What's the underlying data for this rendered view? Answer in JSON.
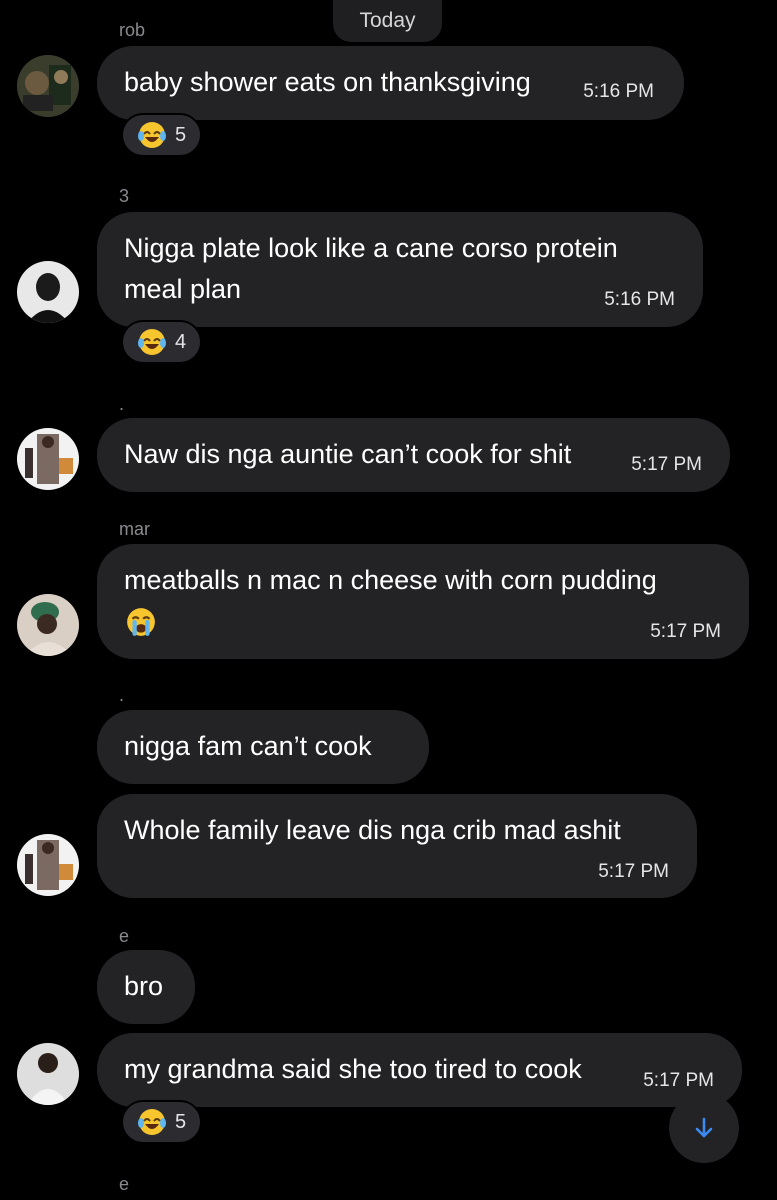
{
  "header": {
    "date_label": "Today"
  },
  "colors": {
    "background": "#000000",
    "bubble": "#232326",
    "accent": "#3d8bf2"
  },
  "messages": [
    {
      "sender": "rob",
      "text": "baby shower eats on thanksgiving",
      "time": "5:16 PM",
      "reaction": {
        "emoji": "laughing-tears-emoji",
        "count": "5"
      }
    },
    {
      "sender": "3",
      "text_lines": [
        "Nigga plate look like a cane corso protein",
        "meal plan"
      ],
      "time": "5:16 PM",
      "reaction": {
        "emoji": "laughing-tears-emoji",
        "count": "4"
      }
    },
    {
      "sender": ".",
      "text": "Naw dis nga auntie can’t cook for shit",
      "time": "5:17 PM"
    },
    {
      "sender": "mar",
      "text": "meatballs n mac n cheese with corn pudding",
      "emoji": "crying-face-emoji",
      "time": "5:17 PM"
    },
    {
      "sender": ".",
      "text": "nigga fam can’t cook"
    },
    {
      "text": "Whole family leave dis nga crib mad ashit",
      "time": "5:17 PM"
    },
    {
      "sender": "e",
      "text": "bro"
    },
    {
      "text": "my grandma said she too tired to cook",
      "time": "5:17 PM",
      "reaction": {
        "emoji": "laughing-tears-emoji",
        "count": "5"
      }
    },
    {
      "sender": "e"
    }
  ],
  "scroll_button": {
    "icon": "arrow-down-icon"
  }
}
